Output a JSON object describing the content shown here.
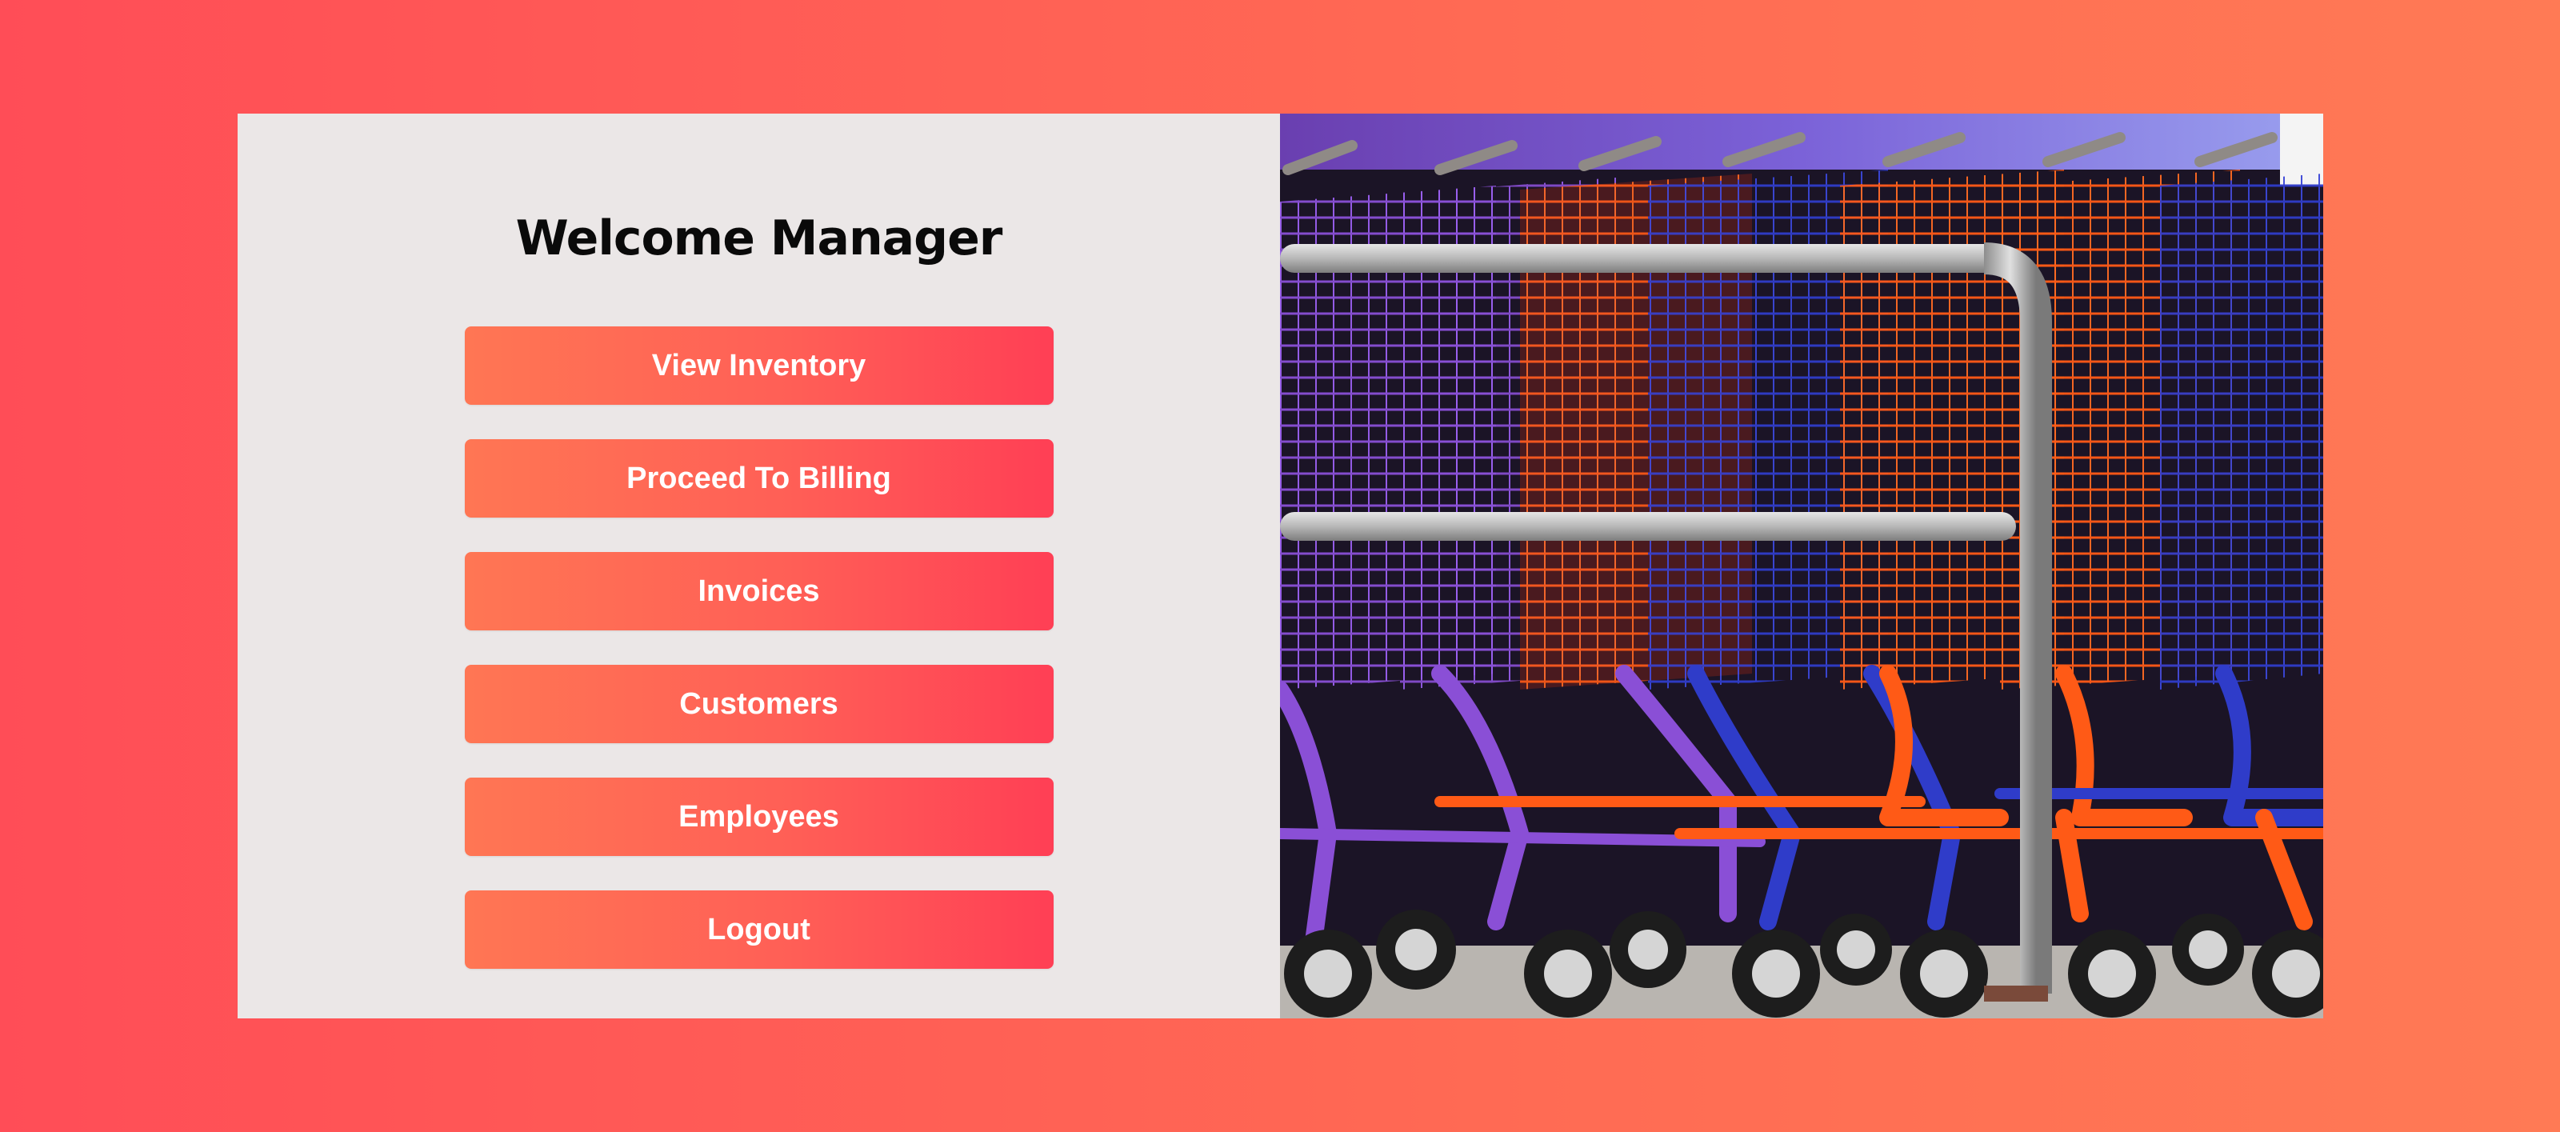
{
  "header": {
    "title": "Welcome Manager"
  },
  "menu": {
    "items": [
      {
        "label": "View Inventory"
      },
      {
        "label": "Proceed To Billing"
      },
      {
        "label": "Invoices"
      },
      {
        "label": "Customers"
      },
      {
        "label": "Employees"
      },
      {
        "label": "Logout"
      }
    ]
  },
  "hero_image": {
    "subject": "row of colorful shopping carts"
  },
  "colors": {
    "background_start": "#ff4d57",
    "background_end": "#ff7a55",
    "panel": "#ebe7e7",
    "button_start": "#ff7654",
    "button_end": "#ff3f55",
    "cart_purple": "#8a4fd6",
    "cart_blue": "#2f3cc9",
    "cart_orange": "#ff5a16"
  }
}
